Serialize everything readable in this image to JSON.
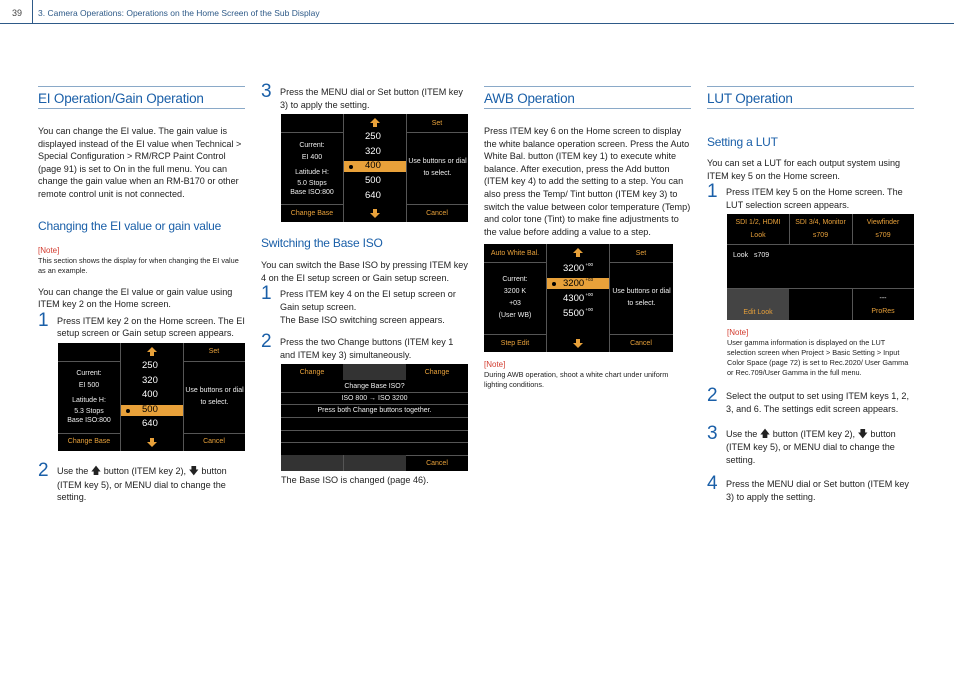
{
  "header": {
    "page_number": "39",
    "chapter_title": "3. Camera Operations: Operations on the Home Screen of the Sub Display"
  },
  "col1": {
    "title": "EI Operation/Gain Operation",
    "intro": "You can change the EI value. The gain value is displayed instead of the EI value when Technical > Special Configuration > RM/RCP Paint Control (page 91) is set to On in the full menu. You can change the gain value when an RM-B170 or other remote control unit is not connected.",
    "subtitle": "Changing the EI value or gain value",
    "note_label": "[Note]",
    "note_text": "This section shows the display for when changing the EI value as an example.",
    "body": "You can change the EI value or gain value using ITEM key 2 on the Home screen.",
    "step1_num": "1",
    "step1_text": "Press ITEM key 2 on the Home screen. The EI setup screen or Gain setup screen appears.",
    "step2_num": "2",
    "step2_a": "Use the",
    "step2_b": "button (ITEM key 2),",
    "step2_c": "button (ITEM key 5), or MENU dial to change the setting.",
    "screen": {
      "current": "Current:",
      "current_value": "EI 500",
      "latitude": "Latitude H:",
      "stops": "5.3 Stops",
      "base": "Base ISO:800",
      "set": "Set",
      "hint": "Use buttons or dial to select.",
      "left_button": "Change Base",
      "cancel": "Cancel",
      "values": [
        "250",
        "320",
        "400",
        "500",
        "640"
      ],
      "selected_index": 3
    }
  },
  "col2": {
    "step3_num": "3",
    "step3_text": "Press the MENU dial or Set button (ITEM key 3) to apply the setting.",
    "screen": {
      "current": "Current:",
      "current_value": "EI 400",
      "latitude": "Latitude H:",
      "stops": "5.0 Stops",
      "base": "Base ISO:800",
      "set": "Set",
      "hint": "Use buttons or dial to select.",
      "left_button": "Change Base",
      "cancel": "Cancel",
      "values": [
        "250",
        "320",
        "400",
        "500",
        "640"
      ],
      "selected_index": 2
    },
    "subtitle": "Switching the Base ISO",
    "body": "You can switch the Base ISO by pressing ITEM key 4 on the EI setup screen or Gain setup screen.",
    "step1_num": "1",
    "step1_text": "Press ITEM key 4 on the EI setup screen or Gain setup screen.",
    "step1_result": "The Base ISO switching screen appears.",
    "step2_num": "2",
    "step2_text": "Press the two Change buttons (ITEM key 1 and ITEM key 3) simultaneously.",
    "iso_screen": {
      "change_left": "Change",
      "change_right": "Change",
      "question": "Change Base ISO?",
      "transition": "ISO 800 → ISO 3200",
      "instruction": "Press both Change buttons together.",
      "cancel": "Cancel"
    },
    "result": "The Base ISO is changed (page 46)."
  },
  "col3": {
    "title": "AWB Operation",
    "body": "Press ITEM key 6 on the Home screen to display the white balance operation screen. Press the Auto White Bal. button (ITEM key 1) to execute white balance. After execution, press the Add button (ITEM key 4) to add the setting to a step. You can also press the Temp/ Tint button (ITEM key 3) to switch the value between color temperature (Temp) and color tone (Tint) to make fine adjustments to the value before adding a value to a step.",
    "screen": {
      "top_left": "Auto White Bal.",
      "set": "Set",
      "current": "Current:",
      "temp": "3200 K",
      "tint": "+03",
      "mode": "(User WB)",
      "hint": "Use buttons or dial to select.",
      "left_button": "Step Edit",
      "cancel": "Cancel",
      "values": [
        {
          "temp": "3200",
          "tint": "+00"
        },
        {
          "temp": "3200",
          "tint": "+03"
        },
        {
          "temp": "4300",
          "tint": "+00"
        },
        {
          "temp": "5500",
          "tint": "+00"
        }
      ],
      "selected_index": 1
    },
    "note_label": "[Note]",
    "note_text": "During AWB operation, shoot a white chart under uniform lighting conditions."
  },
  "col4": {
    "title": "LUT Operation",
    "subtitle": "Setting a LUT",
    "body": "You can set a LUT for each output system using ITEM key 5 on the Home screen.",
    "step1_num": "1",
    "step1_text": "Press ITEM key 5 on the Home screen. The LUT selection screen appears.",
    "screen": {
      "out1": "SDI 1/2, HDMI",
      "out1_val": "Look",
      "out2": "SDI 3/4, Monitor",
      "out2_val": "s709",
      "out3": "Viewfinder",
      "out3_val": "s709",
      "summary": "Look   s709",
      "edit": "Edit Look",
      "dashes": "---",
      "prores": "ProRes"
    },
    "note_label": "[Note]",
    "note_text": "User gamma information is displayed on the LUT selection screen when Project > Basic Setting > Input Color Space (page 72) is set to Rec.2020/ User Gamma or Rec.709/User Gamma in the full menu.",
    "step2_num": "2",
    "step2_text": "Select the output to set using ITEM keys 1, 2, 3, and 6. The settings edit screen appears.",
    "step3_num": "3",
    "step3_a": "Use the",
    "step3_b": "button (ITEM key 2),",
    "step3_c": "button (ITEM key 5), or MENU dial to change the setting.",
    "step4_num": "4",
    "step4_text": "Press the MENU dial or Set button (ITEM key 3) to apply the setting."
  },
  "icons": {
    "up": "▲",
    "down": "▼",
    "arrow_up_glyph": "🡅",
    "arrow_down_glyph": "🡇"
  }
}
